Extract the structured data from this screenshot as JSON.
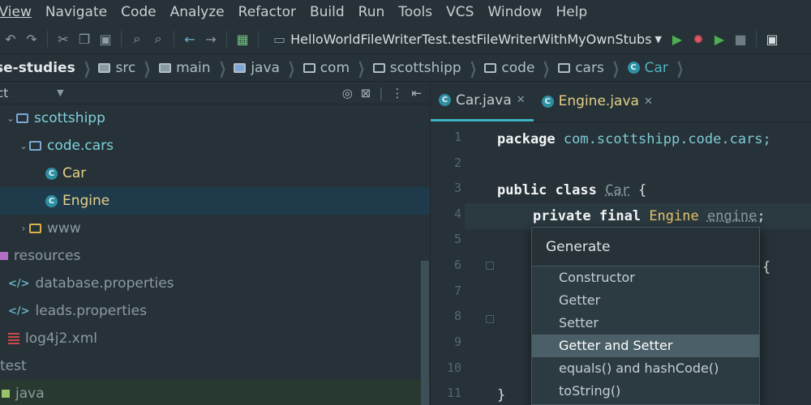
{
  "menu": [
    {
      "label": "View",
      "display": "View"
    },
    {
      "label": "Navigate"
    },
    {
      "label": "Code"
    },
    {
      "label": "Analyze"
    },
    {
      "label": "Refactor"
    },
    {
      "label": "Build"
    },
    {
      "label": "Run"
    },
    {
      "label": "Tools"
    },
    {
      "label": "VCS"
    },
    {
      "label": "Window"
    },
    {
      "label": "Help"
    }
  ],
  "toolbar": {
    "run_config": "HelloWorldFileWriterTest.testFileWriterWithMyOwnStubs"
  },
  "breadcrumb": {
    "project": "se-studies",
    "src": "src",
    "main": "main",
    "java": "java",
    "com": "com",
    "scottshipp": "scottshipp",
    "code": "code",
    "cars": "cars",
    "car": "Car"
  },
  "project_panel": {
    "view_label": "ct",
    "tree": {
      "scottshipp": "scottshipp",
      "code_cars": "code.cars",
      "car": "Car",
      "engine": "Engine",
      "www": "www",
      "resources": "resources",
      "database_properties": "database.properties",
      "leads_properties": "leads.properties",
      "log4j2": "log4j2.xml",
      "test": "test",
      "java": "java"
    }
  },
  "editor": {
    "tabs": [
      {
        "label": "Car.java"
      },
      {
        "label": "Engine.java"
      }
    ],
    "line_numbers": [
      "1",
      "2",
      "3",
      "4",
      "5",
      "6",
      "7",
      "8",
      "9",
      "10",
      "11"
    ],
    "code": {
      "l1_kw": "package",
      "l1_pkg": "com.scottshipp.code.cars;",
      "l3_kw": "public class",
      "l3_cls": "Car",
      "l3_brace": "{",
      "l4_kw": "private final",
      "l4_type": "Engine",
      "l4_field": "engine",
      "l4_semi": ";",
      "l6_brace": "{",
      "l11_brace": "}"
    }
  },
  "generate_popup": {
    "title": "Generate",
    "items": [
      "Constructor",
      "Getter",
      "Setter",
      "Getter and Setter",
      "equals() and hashCode()",
      "toString()"
    ],
    "selected": "Getter and Setter"
  }
}
